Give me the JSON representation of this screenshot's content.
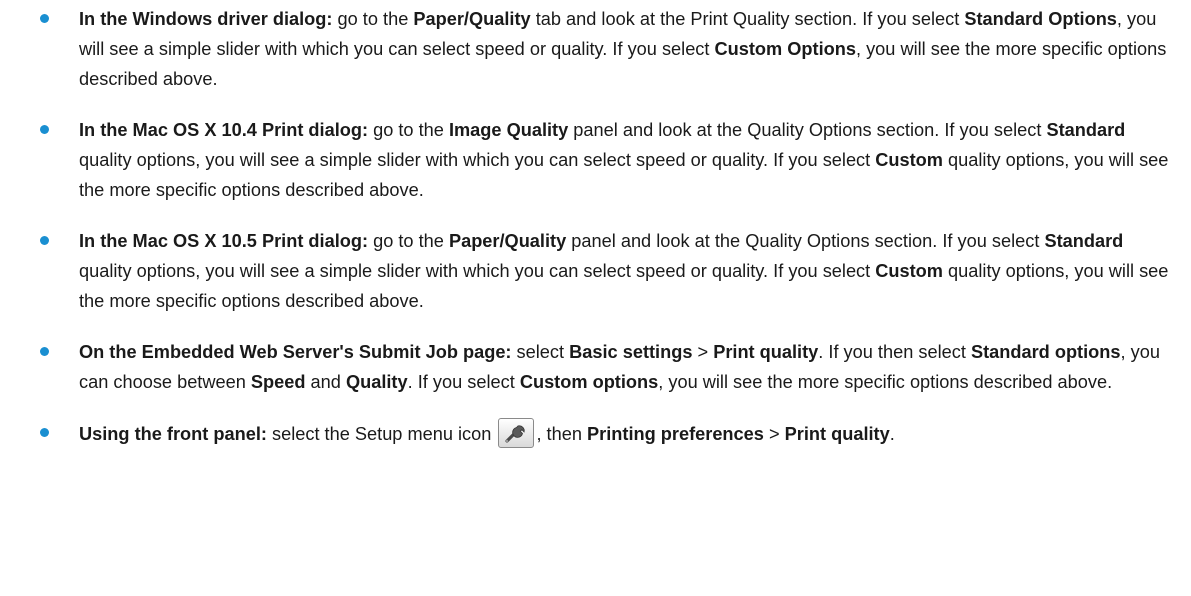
{
  "items": [
    {
      "lead": "In the Windows driver dialog:",
      "t1": " go to the ",
      "b1": "Paper/Quality",
      "t2": " tab and look at the Print Quality section. If you select ",
      "b2": "Standard Options",
      "t3": ", you will see a simple slider with which you can select speed or quality. If you select ",
      "b3": "Custom Options",
      "t4": ", you will see the more specific options described above."
    },
    {
      "lead": "In the Mac OS X 10.4 Print dialog:",
      "t1": " go to the ",
      "b1": "Image Quality",
      "t2": " panel and look at the Quality Options section. If you select ",
      "b2": "Standard",
      "t3": " quality options, you will see a simple slider with which you can select speed or quality. If you select ",
      "b3": "Custom",
      "t4": " quality options, you will see the more specific options described above."
    },
    {
      "lead": "In the Mac OS X 10.5 Print dialog:",
      "t1": " go to the ",
      "b1": "Paper/Quality",
      "t2": " panel and look at the Quality Options section. If you select ",
      "b2": "Standard",
      "t3": " quality options, you will see a simple slider with which you can select speed or quality. If you select ",
      "b3": "Custom",
      "t4": " quality options, you will see the more specific options described above."
    },
    {
      "lead": "On the Embedded Web Server's Submit Job page:",
      "t1": " select ",
      "b1": "Basic settings",
      "t2": " > ",
      "b2": "Print quality",
      "t3": ". If you then select ",
      "b3": "Standard options",
      "t4": ", you can choose between ",
      "b4": "Speed",
      "t5": " and ",
      "b5": "Quality",
      "t6": ". If you select ",
      "b6": "Custom options",
      "t7": ", you will see the more specific options described above."
    },
    {
      "lead": "Using the front panel:",
      "t1": " select the Setup menu icon ",
      "icon": "wrench-icon",
      "t2": ", then ",
      "b1": "Printing preferences",
      "t3": " > ",
      "b2": "Print quality",
      "t4": "."
    }
  ],
  "colors": {
    "bullet": "#1a8fd1",
    "text": "#1a1a1a"
  }
}
